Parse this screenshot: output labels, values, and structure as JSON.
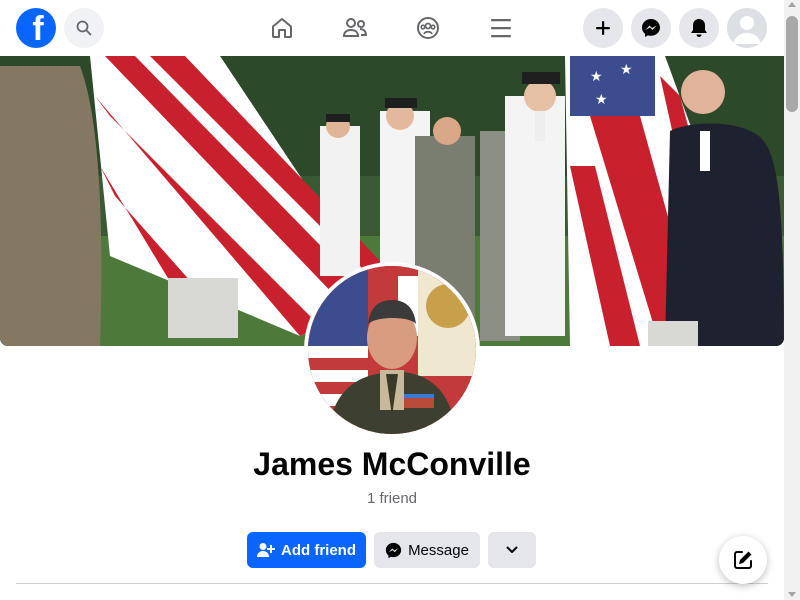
{
  "brand": {
    "logo_glyph": "f",
    "color": "#0866ff"
  },
  "nav": {
    "icons": [
      "home-icon",
      "friends-icon",
      "groups-icon",
      "menu-icon"
    ],
    "actions": [
      "create-plus-icon",
      "messenger-icon",
      "notifications-bell-icon",
      "account-avatar"
    ]
  },
  "profile": {
    "name": "James McConville",
    "friends_count": "1 friend"
  },
  "actions": {
    "add_friend_label": "Add friend",
    "message_label": "Message"
  },
  "colors": {
    "accent": "#0866ff",
    "secondary_bg": "#e4e6eb",
    "muted_text": "#65676b"
  }
}
